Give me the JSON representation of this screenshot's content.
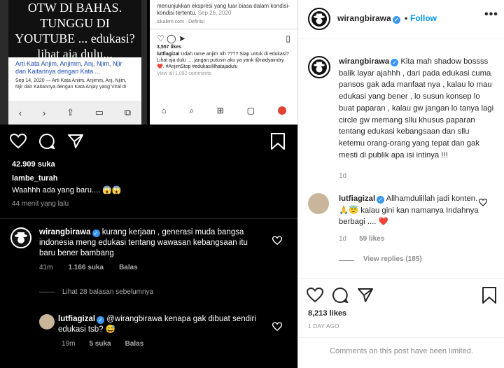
{
  "left_post": {
    "screenshot_1": {
      "headline_lines": [
        "OTW DI BAHAS.",
        "TUNGGU DI",
        "YOUTUBE ... edukasi?",
        "lihat aja dulu..."
      ],
      "article_title": "Arti Kata Anjim, Anjimm, Anj, Njim, Njir dan Kaitannya dengan Kata ...",
      "article_snippet": "Sep 14, 2020 — Arti Kata Anjim, Anjimm, Anj, Njim, Njir dan Kaitannya dengan Kata Anjay yang Viral di"
    },
    "screenshot_2": {
      "text": "menunjukkan ekspresi yang luar biasa dalam kondisi-kondisi tertentu.",
      "date": "Sep 26, 2020",
      "source": "sikalem.com · Definisi",
      "likes": "3,557 likes",
      "caption_user": "lutfiagizal",
      "caption": "Udah rame anjim nih ???? Siap untuk di edukasi? Lihat aja dulu .... jangan putusin aku ya yank @nadyaindry ❤️. #AnjimStop #edukasililhatajadulu",
      "view_all": "View all 1,092 comments"
    },
    "likes": "42.909 suka",
    "top_comment_user": "lambe_turah",
    "top_comment_text": "Waahhh ada yang baru.... 😱😱",
    "top_comment_time": "44 menit yang lalu",
    "comment1": {
      "user": "wirangbirawa",
      "text": "kurang kerjaan , generasi muda bangsa indonesia meng edukasi tentang wawasan kebangsaan itu baru bener bambang",
      "time": "41m",
      "likes": "1.166 suka",
      "reply": "Balas"
    },
    "view_previous": "Lihat 28 balasan sebelumnya",
    "comment2": {
      "user": "lutfiagizal",
      "text": "@wirangbirawa kenapa gak dibuat sendiri edukasi tsb? 😅",
      "time": "19m",
      "likes": "5 suka",
      "reply": "Balas"
    }
  },
  "right_post": {
    "header": {
      "username": "wirangbirawa",
      "separator": "•",
      "follow": "Follow",
      "more": "•••"
    },
    "caption": {
      "user": "wirangbirawa",
      "text": "Kita mah shadow bossss balik layar ajahhh , dari pada edukasi cuma pansos gak ada manfaat nya , kalau lo mau edukasi yang bener , lo susun konsep lo buat paparan , kalau gw jangan lo tanya lagi circle gw memang sllu khusus paparan tentang edukasi kebangsaan dan sllu ketemu orang-orang yang tepat dan gak mesti di publik apa isi intinya !!!",
      "age": "1d"
    },
    "comment": {
      "user": "lutfiagizal",
      "text": "Allhamdulillah jadi konten. 🙏😇 kalau gini kan namanya Indahnya berbagi .... ❤️",
      "age": "1d",
      "likes": "59 likes",
      "view_replies": "View replies (185)"
    },
    "likes": "8,213 likes",
    "time": "1 DAY AGO",
    "comments_limited": "Comments on this post have been limited."
  }
}
